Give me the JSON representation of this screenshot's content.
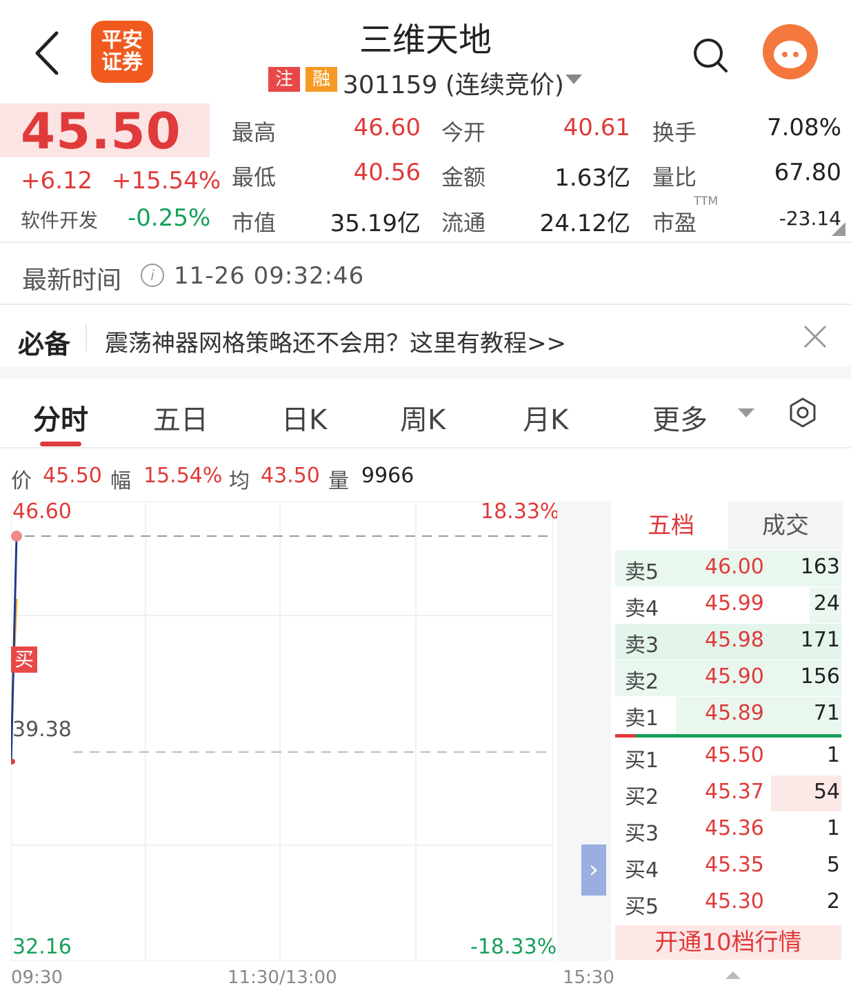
{
  "header": {
    "title": "三维天地",
    "broker_logo_line1": "平安",
    "broker_logo_line2": "证券",
    "badge_zhu": "注",
    "badge_rong": "融",
    "code_status": "301159 (连续竞价)",
    "colors": {
      "logo": "#f05a1e",
      "badge_zhu": "#e84848",
      "badge_rong": "#f59a23"
    }
  },
  "quote": {
    "price": "45.50",
    "change": "+6.12",
    "change_pct": "+15.54%",
    "sector_name": "软件开发",
    "sector_change": "-0.25%",
    "fields": [
      {
        "label": "最高",
        "value": "46.60"
      },
      {
        "label": "最低",
        "value": "40.56"
      },
      {
        "label": "市值",
        "value": "35.19亿"
      },
      {
        "label": "今开",
        "value": "40.61"
      },
      {
        "label": "金额",
        "value": "1.63亿"
      },
      {
        "label": "流通",
        "value": "24.12亿"
      },
      {
        "label": "换手",
        "value": "7.08%"
      },
      {
        "label": "量比",
        "value": "67.80"
      },
      {
        "label": "市盈",
        "value": "-23.14"
      }
    ],
    "pe_sup": "TTM"
  },
  "time": {
    "label": "最新时间",
    "value": "11-26 09:32:46"
  },
  "banner": {
    "title": "必备",
    "text": "震荡神器网格策略还不会用？这里有教程>>"
  },
  "tabs": [
    "分时",
    "五日",
    "日K",
    "周K",
    "月K",
    "更多"
  ],
  "chart_stats": {
    "price_label": "价",
    "price": "45.50",
    "amp_label": "幅",
    "amp": "15.54%",
    "avg_label": "均",
    "avg": "43.50",
    "vol_label": "量",
    "vol": "9966"
  },
  "chart_data": {
    "type": "line",
    "title": "",
    "xlabel": "",
    "ylabel": "",
    "x_ticks": [
      "09:30",
      "11:30/13:00",
      "15:30"
    ],
    "y_left_ticks": [
      "46.60",
      "39.38",
      "32.16"
    ],
    "y_right_ticks": [
      "18.33%",
      "-18.33%"
    ],
    "ylim": [
      32.16,
      46.6
    ],
    "reference": 39.38,
    "series": [
      {
        "values": [
          39.2,
          46.6
        ]
      },
      {
        "values": [
          41.2,
          44.5
        ]
      }
    ],
    "buy_marker": "买",
    "grid": true
  },
  "order_book": {
    "tabs": [
      "五档",
      "成交"
    ],
    "asks": [
      {
        "label": "卖5",
        "price": "46.00",
        "vol": "163"
      },
      {
        "label": "卖4",
        "price": "45.99",
        "vol": "24"
      },
      {
        "label": "卖3",
        "price": "45.98",
        "vol": "171"
      },
      {
        "label": "卖2",
        "price": "45.90",
        "vol": "156"
      },
      {
        "label": "卖1",
        "price": "45.89",
        "vol": "71"
      }
    ],
    "bids": [
      {
        "label": "买1",
        "price": "45.50",
        "vol": "1"
      },
      {
        "label": "买2",
        "price": "45.37",
        "vol": "54"
      },
      {
        "label": "买3",
        "price": "45.36",
        "vol": "1"
      },
      {
        "label": "买4",
        "price": "45.35",
        "vol": "5"
      },
      {
        "label": "买5",
        "price": "45.30",
        "vol": "2"
      }
    ],
    "open_more": "开通10档行情",
    "expand_glyph": "›"
  }
}
